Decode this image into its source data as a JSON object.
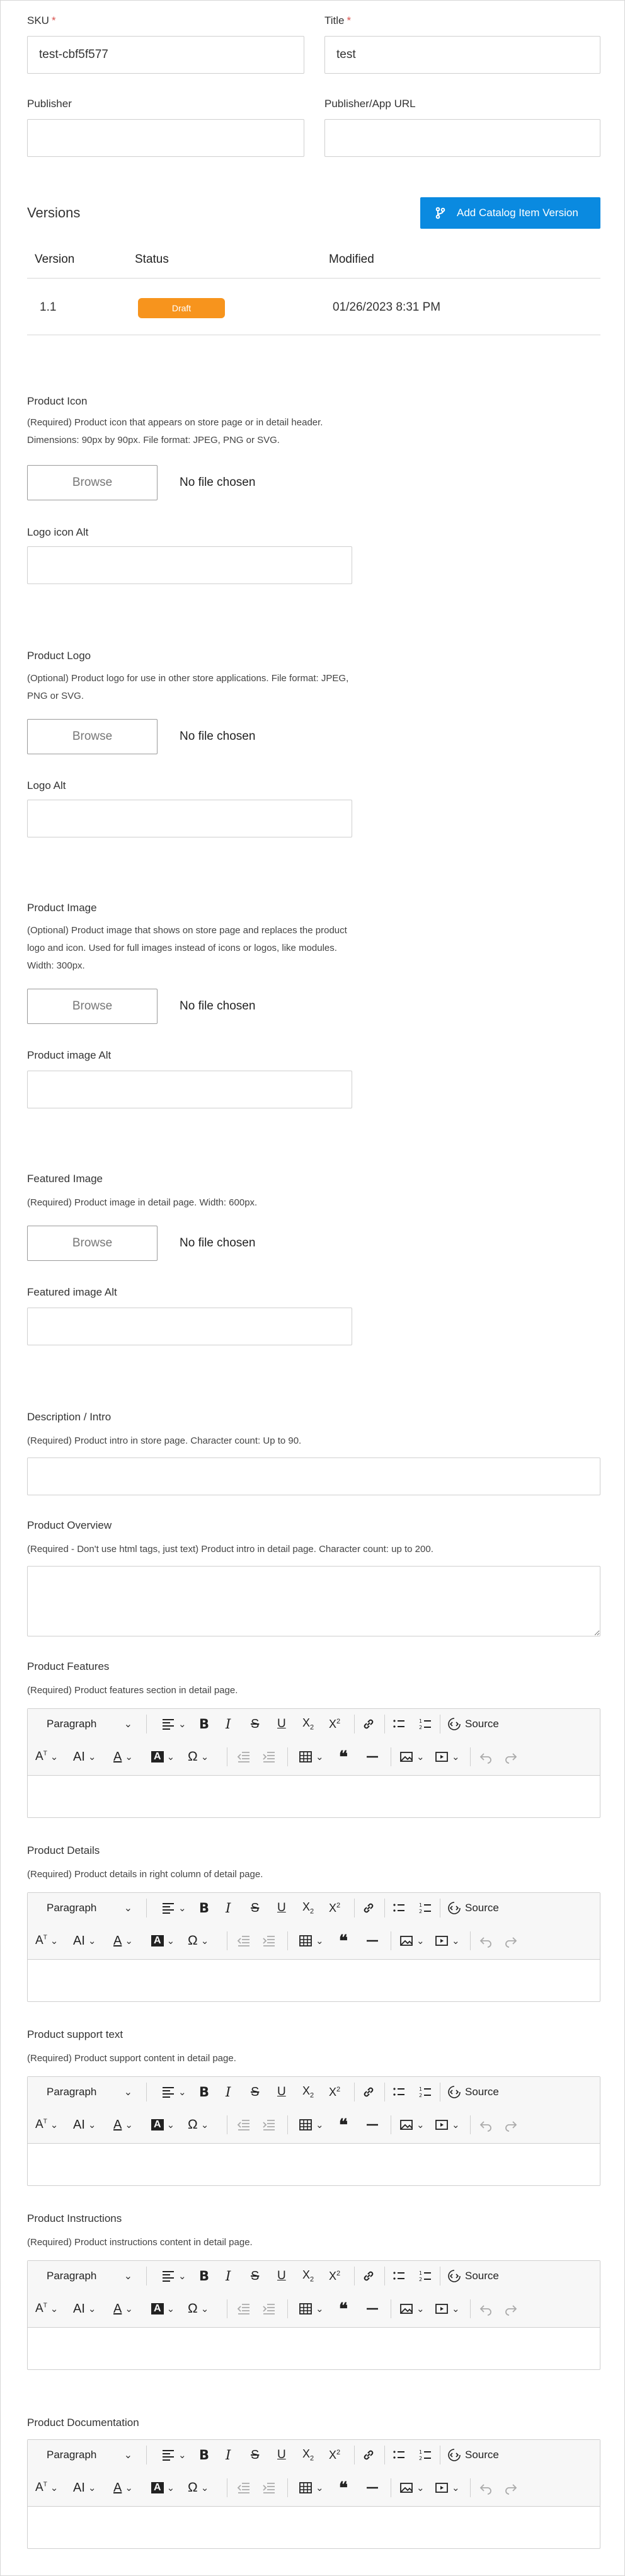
{
  "fields": {
    "sku": {
      "label": "SKU",
      "value": "test-cbf5f577"
    },
    "title": {
      "label": "Title",
      "value": "test"
    },
    "publisher": {
      "label": "Publisher",
      "value": ""
    },
    "publisher_url": {
      "label": "Publisher/App URL",
      "value": ""
    },
    "required_mark": "*"
  },
  "versions": {
    "title": "Versions",
    "add_button": "Add Catalog Item Version",
    "columns": [
      "Version",
      "Status",
      "Modified"
    ],
    "rows": [
      {
        "version": "1.1",
        "status": "Draft",
        "modified": "01/26/2023 8:31 PM"
      }
    ]
  },
  "uploads": {
    "browse_label": "Browse",
    "no_file": "No file chosen",
    "product_icon": {
      "title": "Product Icon",
      "help": "(Required) Product icon that appears on store page or in detail header. Dimensions: 90px by 90px. File format: JPEG, PNG or SVG.",
      "alt_label": "Logo icon Alt"
    },
    "product_logo": {
      "title": "Product Logo",
      "help": "(Optional) Product logo for use in other store applications. File format: JPEG, PNG or SVG.",
      "alt_label": "Logo Alt"
    },
    "product_image": {
      "title": "Product Image",
      "help": "(Optional) Product image that shows on store page and replaces the product logo and icon. Used for full images instead of icons or logos, like modules. Width: 300px.",
      "alt_label": "Product image Alt"
    },
    "featured_image": {
      "title": "Featured Image",
      "help": "(Required) Product image in detail page. Width: 600px.",
      "alt_label": "Featured image Alt"
    }
  },
  "description": {
    "title": "Description / Intro",
    "help": "(Required) Product intro in store page. Character count: Up to 90."
  },
  "overview": {
    "title": "Product Overview",
    "help": "(Required - Don't use html tags, just text) Product intro in detail page. Character count: up to 200."
  },
  "editors": {
    "paragraph": "Paragraph",
    "source": "Source",
    "features": {
      "title": "Product Features",
      "help": "(Required) Product features section in detail page."
    },
    "details": {
      "title": "Product Details",
      "help": "(Required) Product details in right column of detail page."
    },
    "support": {
      "title": "Product support text",
      "help": "(Required) Product support content in detail page."
    },
    "instructions": {
      "title": "Product Instructions",
      "help": "(Required) Product instructions content in detail page."
    },
    "documentation": {
      "title": "Product Documentation"
    }
  },
  "colors": {
    "primary": "#0a8ae0",
    "draft": "#f7941d",
    "required": "#d9534f"
  }
}
